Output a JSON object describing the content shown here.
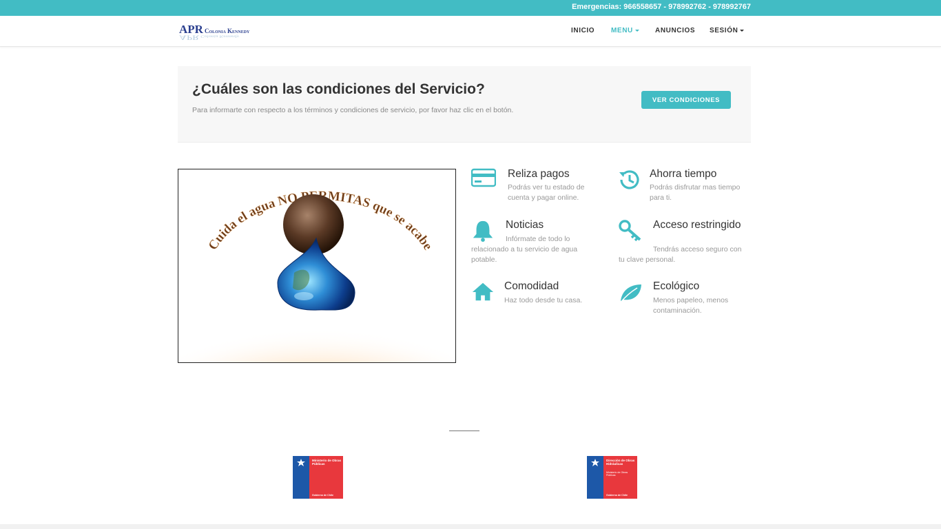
{
  "topbar": {
    "phones": "Emergencias: 966558657 - 978992762 - 978992767"
  },
  "logo": {
    "main": "APR",
    "sub": "Colonia Kennedy"
  },
  "nav": [
    {
      "label": "INICIO",
      "active": false,
      "dropdown": false
    },
    {
      "label": "MENU",
      "active": true,
      "dropdown": true
    },
    {
      "label": "ANUNCIOS",
      "active": false,
      "dropdown": false
    },
    {
      "label": "SESIÓN",
      "active": false,
      "dropdown": true
    }
  ],
  "cta": {
    "title": "¿Cuáles son las condiciones del Servicio?",
    "text": "Para informarte con respecto a los términos y condiciones de servicio, por favor haz clic en el botón.",
    "button": "VER CONDICIONES"
  },
  "poster": {
    "text": "Cuida el agua NO PERMITAS que se acabe"
  },
  "features": [
    {
      "icon": "credit-card-icon",
      "title": "Reliza pagos",
      "text": "Podrás ver tu estado de cuenta y pagar online."
    },
    {
      "icon": "history-icon",
      "title": "Ahorra tiempo",
      "text": "Podrás disfrutar mas tiempo para ti."
    },
    {
      "icon": "bell-icon",
      "title": "Noticias",
      "text": "Infórmate de todo lo relacionado a tu servicio de agua potable."
    },
    {
      "icon": "key-icon",
      "title": "Acceso restringido",
      "text": "Tendrás acceso seguro con tu clave personal."
    },
    {
      "icon": "home-icon",
      "title": "Comodidad",
      "text": "Haz todo desde tu casa."
    },
    {
      "icon": "leaf-icon",
      "title": "Ecológico",
      "text": "Menos papeleo, menos contaminación."
    }
  ],
  "logos": [
    {
      "name": "Ministerio de Obras Públicas",
      "gov": "Gobierno de Chile",
      "extra": ""
    },
    {
      "name": "Dirección de Obras Hidráulicas",
      "gov": "Gobierno de Chile",
      "extra": "Ministerio de Obras Públicas"
    }
  ],
  "colors": {
    "accent": "#42bcc4",
    "flag_blue": "#1d58a8",
    "flag_red": "#e8383d"
  }
}
